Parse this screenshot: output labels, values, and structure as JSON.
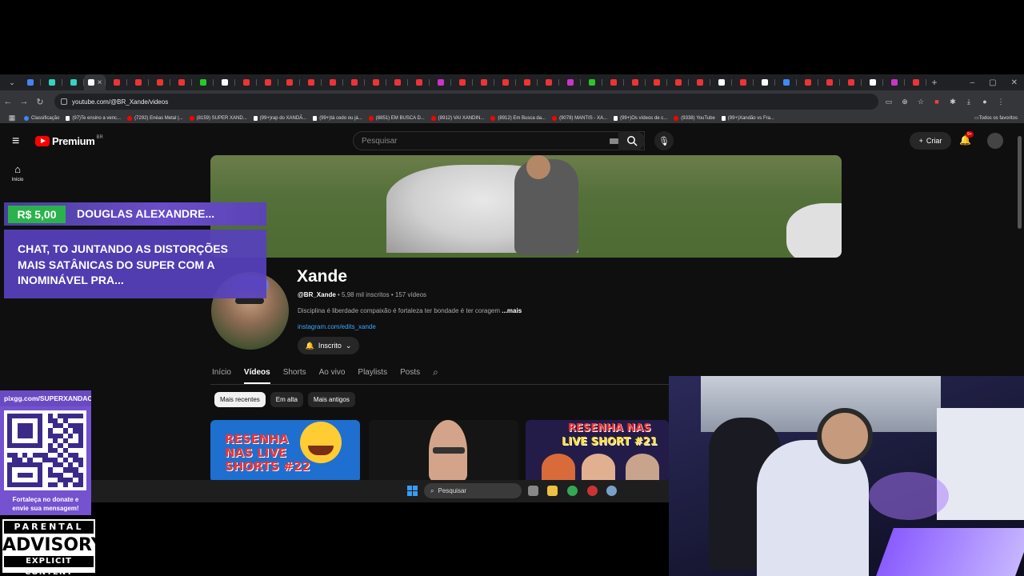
{
  "browser": {
    "url": "youtube.com/@BR_Xande/videos",
    "tab_count": 42,
    "bookmarks": [
      {
        "label": "Classificação",
        "kind": "g"
      },
      {
        "label": "(97)Te ensino a venc...",
        "kind": "tt"
      },
      {
        "label": "(7292) Enéas Metal |...",
        "kind": "yt"
      },
      {
        "label": "(8159) SUPER XAND...",
        "kind": "yt"
      },
      {
        "label": "(99+)rap do XANDÃ...",
        "kind": "tt"
      },
      {
        "label": "(99+)tá cedo ou já...",
        "kind": "tt"
      },
      {
        "label": "(8851) EM BUSCA D...",
        "kind": "yt"
      },
      {
        "label": "(8912) VAI XANDIN...",
        "kind": "yt"
      },
      {
        "label": "(8912) Em Busca da...",
        "kind": "yt"
      },
      {
        "label": "(9078) MANTIS - XA...",
        "kind": "yt"
      },
      {
        "label": "(99+)Os vídeos de c...",
        "kind": "tt"
      },
      {
        "label": "(9338) YouTube",
        "kind": "yt"
      },
      {
        "label": "(99+)Xandão vs Fra...",
        "kind": "tt"
      }
    ],
    "all_bookmarks": "Todos os favoritos"
  },
  "youtube": {
    "logo_text": "Premium",
    "logo_country": "BR",
    "search_placeholder": "Pesquisar",
    "create_label": "Criar",
    "notifications_badge": "9+",
    "sidebar_home": "Início",
    "channel": {
      "name": "Xande",
      "handle": "@BR_Xande",
      "stats": " • 5,98 mil inscritos • 157 vídeos",
      "description": "Disciplina é liberdade compaixão é fortaleza ter bondade é ter coragem ",
      "more": "...mais",
      "link": "instagram.com/edits_xande",
      "subscribe_label": "Inscrito"
    },
    "tabs": [
      "Início",
      "Vídeos",
      "Shorts",
      "Ao vivo",
      "Playlists",
      "Posts"
    ],
    "selected_tab": 1,
    "chips": [
      "Mais recentes",
      "Em alta",
      "Mais antigos"
    ],
    "selected_chip": 0,
    "thumbnails": {
      "t1_line1": "RESENHA",
      "t1_line2": "NAS LIVE",
      "t1_line3": "SHORTS #22",
      "t3_line1": "RESENHA NAS",
      "t3_line2": "LIVE SHORT #21"
    }
  },
  "taskbar": {
    "search_placeholder": "Pesquisar"
  },
  "overlay": {
    "donation_amount": "R$ 5,00",
    "donor_name": "DOUGLAS ALEXANDRE...",
    "donation_message": "CHAT, TO JUNTANDO AS DISTORÇÕES MAIS SATÂNICAS DO SUPER COM A INOMINÁVEL PRA...",
    "pix_url": "pixgg.com/SUPERXANDAO",
    "pix_cta_line1": "Fortaleça no donate e",
    "pix_cta_line2": "envie sua mensagem!",
    "advisory_top": "PARENTAL",
    "advisory_mid": "ADVISORY",
    "advisory_bottom": "EXPLICIT CONTENT"
  },
  "colors": {
    "youtube_red": "#ff0000",
    "overlay_purple": "#6a4dc9",
    "donation_green": "#2bb24c",
    "link_blue": "#3ea6ff"
  }
}
